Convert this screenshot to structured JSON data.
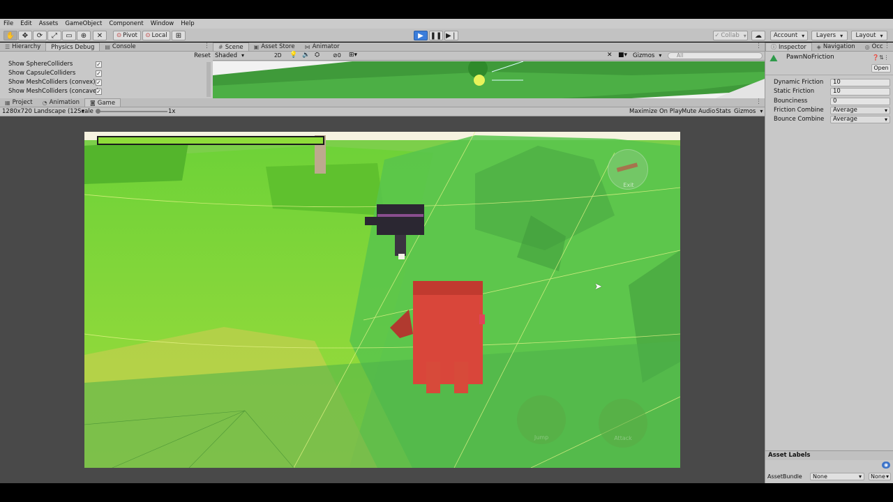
{
  "menu": [
    "File",
    "Edit",
    "Assets",
    "GameObject",
    "Component",
    "Window",
    "Help"
  ],
  "toolbar": {
    "pivot_label": "Pivot",
    "local_label": "Local",
    "collab_label": "Collab",
    "account_label": "Account",
    "layers_label": "Layers",
    "layout_label": "Layout"
  },
  "left_tabs": [
    "Hierarchy",
    "Physics Debug",
    "Console"
  ],
  "physics_debug": {
    "reset_label": "Reset",
    "rows": [
      "Show SphereColliders",
      "Show CapsuleColliders",
      "Show MeshColliders (convex)",
      "Show MeshColliders (concave)"
    ]
  },
  "scene_tabs": [
    "Scene",
    "Asset Store",
    "Animator"
  ],
  "scene_toolbar": {
    "shading": "Shaded",
    "mode_2d": "2D",
    "gizmos": "Gizmos",
    "search_placeholder": "All",
    "effects_count": "0"
  },
  "game_tabs": [
    "Project",
    "Animation",
    "Game"
  ],
  "game_toolbar": {
    "resolution": "1280x720 Landscape (12",
    "scale_label": "Scale",
    "scale_value": "1x",
    "maximize": "Maximize On Play",
    "mute": "Mute Audio",
    "stats": "Stats",
    "gizmos": "Gizmos"
  },
  "game_ui": {
    "exit": "Exit",
    "jump": "Jump",
    "attack": "Attack"
  },
  "inspector": {
    "tabs": [
      "Inspector",
      "Navigation",
      "Occ"
    ],
    "asset_name": "PawnNoFriction",
    "open_label": "Open",
    "fields": [
      {
        "label": "Dynamic Friction",
        "value": "10",
        "type": "number"
      },
      {
        "label": "Static Friction",
        "value": "10",
        "type": "number"
      },
      {
        "label": "Bounciness",
        "value": "0",
        "type": "number"
      },
      {
        "label": "Friction Combine",
        "value": "Average",
        "type": "select"
      },
      {
        "label": "Bounce Combine",
        "value": "Average",
        "type": "select"
      }
    ],
    "asset_labels": "Asset Labels",
    "asset_bundle_label": "AssetBundle",
    "asset_bundle_value": "None",
    "asset_bundle_variant": "None"
  }
}
